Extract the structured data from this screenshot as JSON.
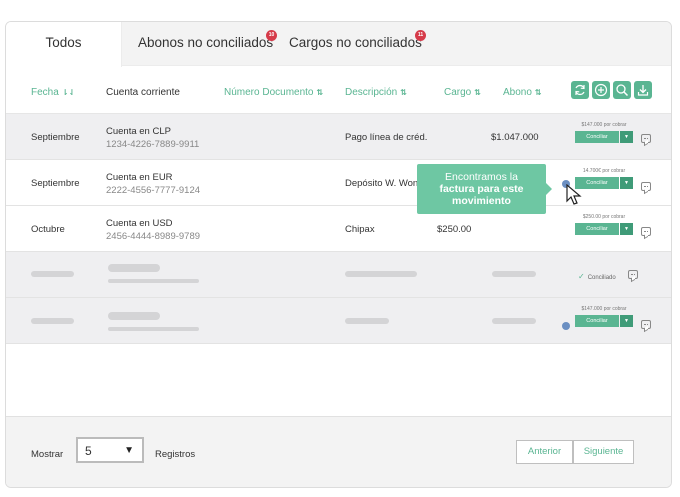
{
  "tabs": [
    {
      "label": "Todos",
      "badge": ""
    },
    {
      "label": "Abonos no conciliados",
      "badge": "10"
    },
    {
      "label": "Cargos no conciliados",
      "badge": "11"
    }
  ],
  "columns": {
    "fecha": "Fecha",
    "cuenta": "Cuenta corriente",
    "numero": "Número Documento",
    "descripcion": "Descripción",
    "cargo": "Cargo",
    "abono": "Abono"
  },
  "toolbar_icons": [
    "refresh-icon",
    "add-icon",
    "search-icon",
    "download-icon"
  ],
  "rows": [
    {
      "fecha": "Septiembre",
      "cuenta": "Cuenta en CLP",
      "numero": "1234-4226-7889-9911",
      "descripcion": "Pago línea de créd.",
      "cargo": "",
      "abono": "$1.047.000",
      "note": "$147.000 por cobrar",
      "button": "Conciliar"
    },
    {
      "fecha": "Septiembre",
      "cuenta": "Cuenta en EUR",
      "numero": "2222-4556-7777-9124",
      "descripcion": "Depósito W. Won",
      "cargo": "",
      "abono": "",
      "note": "14.700€ por cobrar",
      "button": "Conciliar"
    },
    {
      "fecha": "Octubre",
      "cuenta": "Cuenta en USD",
      "numero": "2456-4444-8989-9789",
      "descripcion": "Chipax",
      "cargo": "$250.00",
      "abono": "",
      "note": "$250.00 por cobrar",
      "button": "Conciliar"
    }
  ],
  "placeholder_rows": [
    {
      "status": "Conciliado"
    },
    {
      "note": "$147.000 por cobrar",
      "button": "Conciliar"
    }
  ],
  "tooltip": {
    "line1": "Encontramos la",
    "line2": "factura para este",
    "line3": "movimiento"
  },
  "footer": {
    "show_label": "Mostrar",
    "page_size": "5",
    "records_label": "Registros",
    "prev": "Anterior",
    "next": "Siguiente"
  },
  "colors": {
    "accent": "#5ab592",
    "accent_dark": "#3f9b78",
    "badge": "#d63b4a",
    "tooltip": "#6ec7a3"
  }
}
